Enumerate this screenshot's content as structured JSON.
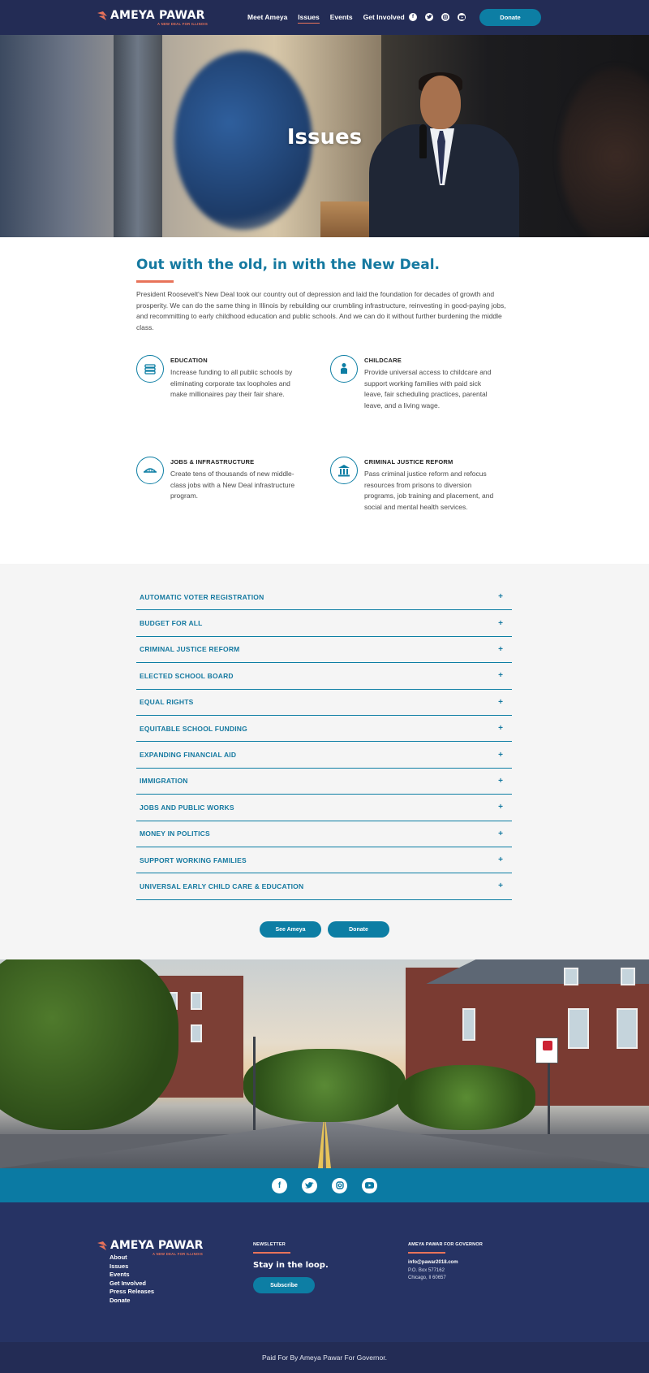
{
  "brand": {
    "name": "AMEYA PAWAR",
    "tagline": "A NEW DEAL FOR ILLINOIS"
  },
  "nav": {
    "links": [
      {
        "label": "Meet Ameya",
        "active": false
      },
      {
        "label": "Issues",
        "active": true
      },
      {
        "label": "Events",
        "active": false
      },
      {
        "label": "Get Involved",
        "active": false
      }
    ],
    "social_icons": [
      "facebook-icon",
      "twitter-icon",
      "instagram-icon",
      "youtube-icon"
    ],
    "donate_label": "Donate"
  },
  "hero": {
    "title": "Issues"
  },
  "intro": {
    "title": "Out with the old, in with the New Deal.",
    "text": "President Roosevelt's New Deal took our country out of depression and laid the foundation for decades of growth and prosperity. We can do the same thing in Illinois by rebuilding our crumbling infrastructure, reinvesting in good-paying jobs, and recommitting to early childhood education and public schools. And we can do it without further burdening the middle class."
  },
  "issues": [
    {
      "icon": "books-icon",
      "heading": "EDUCATION",
      "text": "Increase funding to all public schools by eliminating corporate tax loopholes and make millionaires pay their fair share."
    },
    {
      "icon": "child-icon",
      "heading": "CHILDCARE",
      "text": "Provide universal access to childcare and support working families with paid sick leave, fair scheduling practices, parental leave, and a living wage."
    },
    {
      "icon": "bridge-icon",
      "heading": "JOBS & INFRASTRUCTURE",
      "text": "Create tens of thousands of new middle-class jobs with a New Deal infrastructure program."
    },
    {
      "icon": "courthouse-icon",
      "heading": "CRIMINAL JUSTICE REFORM",
      "text": "Pass criminal justice reform and refocus resources from prisons to diversion programs, job training and placement, and social and mental health services."
    }
  ],
  "accordion": {
    "items": [
      "AUTOMATIC VOTER REGISTRATION",
      "BUDGET FOR ALL",
      "CRIMINAL JUSTICE REFORM",
      "ELECTED SCHOOL BOARD",
      "EQUAL RIGHTS",
      "EQUITABLE SCHOOL FUNDING",
      "EXPANDING FINANCIAL AID",
      "IMMIGRATION",
      "JOBS AND PUBLIC WORKS",
      "MONEY IN POLITICS",
      "SUPPORT WORKING FAMILIES",
      "UNIVERSAL EARLY CHILD CARE & EDUCATION"
    ],
    "expand_symbol": "+",
    "buttons": {
      "see": "See Ameya",
      "donate": "Donate"
    }
  },
  "social_bar": {
    "icons": [
      "facebook-icon",
      "twitter-icon",
      "instagram-icon",
      "youtube-icon"
    ]
  },
  "footer": {
    "links": [
      "About",
      "Issues",
      "Events",
      "Get Involved",
      "Press Releases",
      "Donate"
    ],
    "newsletter_heading": "NEWSLETTER",
    "newsletter_title": "Stay in the loop.",
    "subscribe_label": "Subscribe",
    "contact_heading": "AMEYA PAWAR FOR GOVERNOR",
    "email": "info@pawar2018.com",
    "po_box": "P.O. Box 577162",
    "city": "Chicago, Il 60657",
    "paid_for": "Paid For By Ameya Pawar For Governor."
  },
  "colors": {
    "navy": "#232c55",
    "footer_navy": "#263364",
    "accent_blue": "#0d7ea4",
    "heading_blue": "#1579a0",
    "accent_orange": "#e8735a"
  }
}
